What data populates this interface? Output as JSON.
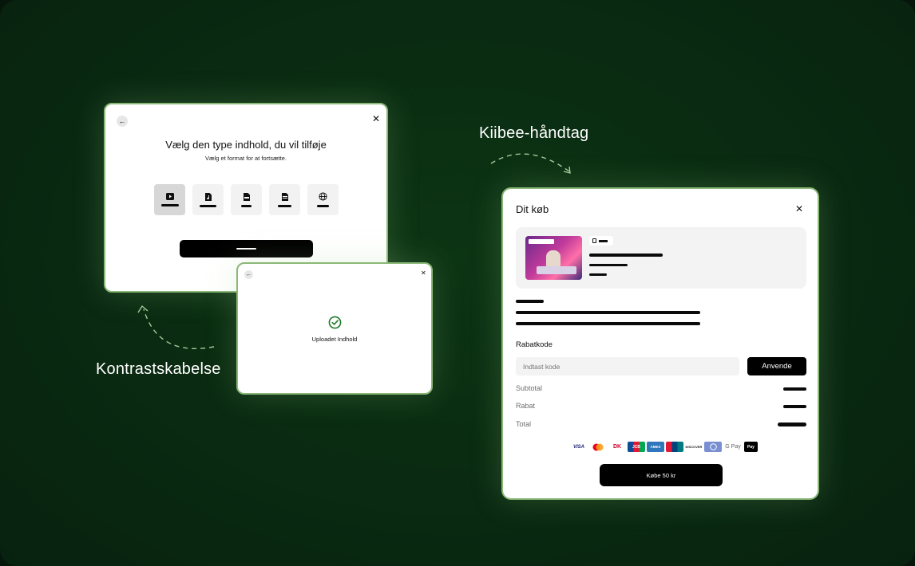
{
  "annotations": {
    "top_right_label": "Kiibee-håndtag",
    "bottom_left_label": "Kontrastskabelse"
  },
  "select_dialog": {
    "title": "Vælg den type indhold, du vil tilføje",
    "subtitle": "Vælg et format for at fortsætte.",
    "formats": [
      {
        "icon": "video-icon",
        "selected": true
      },
      {
        "icon": "audio-file-icon",
        "selected": false
      },
      {
        "icon": "pdf-file-icon",
        "selected": false
      },
      {
        "icon": "document-file-icon",
        "selected": false
      },
      {
        "icon": "globe-icon",
        "selected": false
      }
    ]
  },
  "upload_dialog": {
    "status_text": "Uploadet Indhold",
    "status_icon": "check-circle-icon"
  },
  "purchase_dialog": {
    "title": "Dit køb",
    "discount": {
      "label": "Rabatkode",
      "placeholder": "Indtast kode",
      "apply_label": "Anvende"
    },
    "summary_labels": [
      "Subtotal",
      "Rabat",
      "Total"
    ],
    "payment_methods": [
      "VISA",
      "Mastercard",
      "Dankort",
      "JCB",
      "AMEX",
      "UnionPay",
      "DISCOVER",
      "Diners",
      "G Pay",
      "Apple Pay"
    ],
    "buy_label": "Købe 50 kr"
  },
  "colors": {
    "background": "#0a2c11",
    "panel_border": "#8ab877",
    "success_green": "#1f7a2a",
    "primary_button": "#000000"
  }
}
